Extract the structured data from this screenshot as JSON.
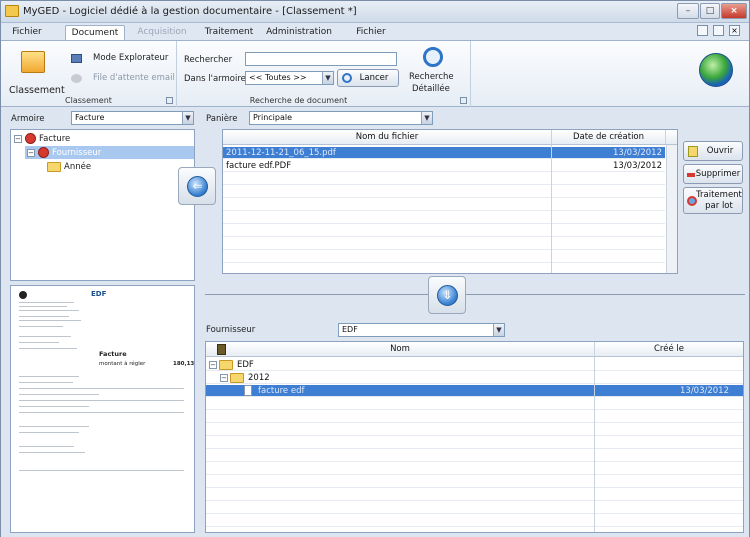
{
  "window": {
    "title": "MyGED - Logiciel dédié à la gestion documentaire - [Classement *]"
  },
  "menu": {
    "items": [
      "Fichier",
      "Document",
      "Acquisition",
      "Traitement",
      "Administration",
      "Fichier"
    ]
  },
  "ribbon": {
    "classement": {
      "big_button": "Classement",
      "mode_explorateur": "Mode Explorateur",
      "file_attente": "File d'attente email",
      "group_label": "Classement"
    },
    "recherche": {
      "rechercher_label": "Rechercher",
      "rechercher_value": "",
      "armoire_label": "Dans l'armoire",
      "armoire_value": "<< Toutes >>",
      "lancer": "Lancer",
      "detaillee_line1": "Recherche",
      "detaillee_line2": "Détaillée",
      "group_label": "Recherche de document"
    }
  },
  "left": {
    "armoire_label": "Armoire",
    "armoire_value": "Facture",
    "tree": {
      "root": "Facture",
      "child": "Fournisseur",
      "leaf": "Année"
    }
  },
  "panier": {
    "label": "Panière",
    "value": "Principale",
    "columns": [
      "Nom du fichier",
      "Date de création"
    ],
    "rows": [
      {
        "name": "2011-12-11-21_06_15.pdf",
        "date": "13/03/2012"
      },
      {
        "name": "facture edf.PDF",
        "date": "13/03/2012"
      }
    ],
    "actions": {
      "ouvrir": "Ouvrir",
      "supprimer": "Supprimer",
      "traitement_line1": "Traitement",
      "traitement_line2": "par lot"
    }
  },
  "fournisseur": {
    "label": "Fournisseur",
    "value": "EDF",
    "columns": [
      "Nom",
      "Créé le"
    ],
    "tree": {
      "level1": "EDF",
      "level2": "2012",
      "file": "facture edf",
      "file_date": "13/03/2012"
    }
  },
  "preview": {
    "brand": "EDF",
    "note": "Facture",
    "amount": "180,13",
    "amount_label": "montant à régler"
  },
  "colors": {
    "selection": "#3f7fd3",
    "accent": "#2e74c9"
  }
}
